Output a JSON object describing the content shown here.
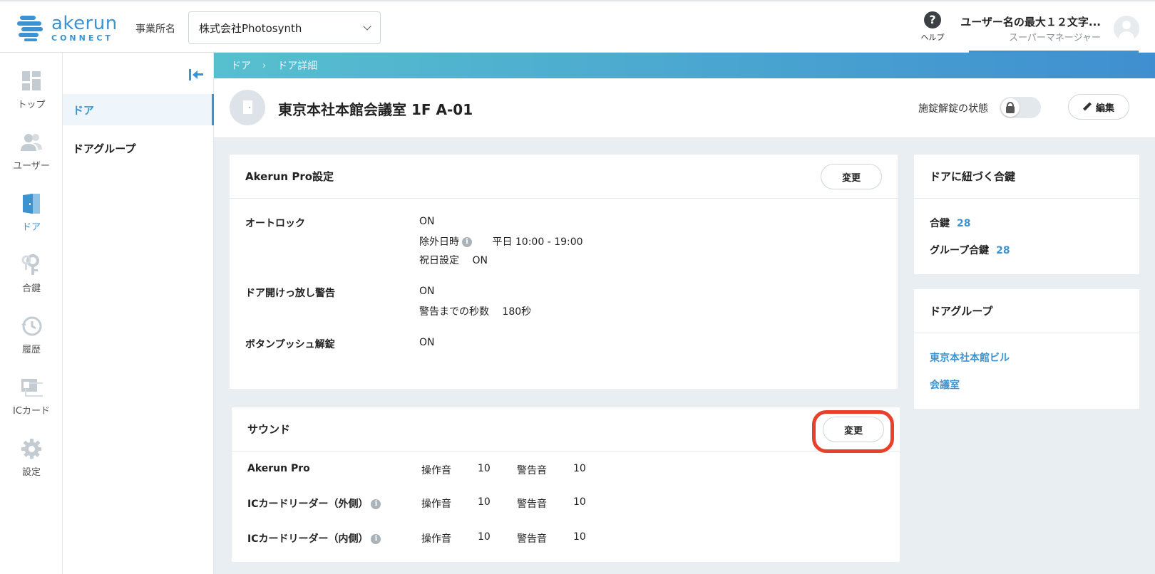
{
  "header": {
    "logo_text": "akerun",
    "logo_sub": "CONNECT",
    "office_label": "事業所名",
    "office_value": "株式会社Photosynth",
    "help_label": "ヘルプ",
    "user_name": "ユーザー名の最大１２文字...",
    "user_role": "スーパーマネージャー"
  },
  "rail": {
    "items": [
      {
        "label": "トップ",
        "icon": "dashboard-icon"
      },
      {
        "label": "ユーザー",
        "icon": "users-icon"
      },
      {
        "label": "ドア",
        "icon": "door-icon"
      },
      {
        "label": "合鍵",
        "icon": "key-icon"
      },
      {
        "label": "履歴",
        "icon": "history-icon"
      },
      {
        "label": "ICカード",
        "icon": "ic-card-icon"
      },
      {
        "label": "設定",
        "icon": "gear-icon"
      }
    ],
    "active_index": 2
  },
  "subnav": {
    "items": [
      {
        "label": "ドア"
      },
      {
        "label": "ドアグループ"
      }
    ]
  },
  "breadcrumb": {
    "items": [
      "ドア",
      "ドア詳細"
    ],
    "separator": "›"
  },
  "title": {
    "name": "東京本社本館会議室 1F A-01",
    "lock_state_label": "施錠解錠の状態",
    "edit_label": "編集"
  },
  "akerun_pro": {
    "heading": "Akerun Pro設定",
    "change_label": "変更",
    "autolock_label": "オートロック",
    "autolock_value": "ON",
    "exclusion_label": "除外日時",
    "exclusion_value": "平日 10:00 - 19:00",
    "holiday_label": "祝日設定",
    "holiday_value": "ON",
    "door_open_label": "ドア開けっ放し警告",
    "door_open_value": "ON",
    "warning_seconds_label": "警告までの秒数",
    "warning_seconds_value": "180秒",
    "button_push_label": "ボタンプッシュ解錠",
    "button_push_value": "ON"
  },
  "sound": {
    "heading": "サウンド",
    "change_label": "変更",
    "rows": [
      {
        "device": "Akerun Pro",
        "op_label": "操作音",
        "op_value": "10",
        "warn_label": "警告音",
        "warn_value": "10"
      },
      {
        "device": "ICカードリーダー（外側）",
        "op_label": "操作音",
        "op_value": "10",
        "warn_label": "警告音",
        "warn_value": "10"
      },
      {
        "device": "ICカードリーダー（内側）",
        "op_label": "操作音",
        "op_value": "10",
        "warn_label": "警告音",
        "warn_value": "10"
      }
    ]
  },
  "keys": {
    "heading": "ドアに紐づく合鍵",
    "key_label": "合鍵",
    "key_count": "28",
    "group_key_label": "グループ合鍵",
    "group_key_count": "28"
  },
  "door_groups": {
    "heading": "ドアグループ",
    "items": [
      "東京本社本館ビル",
      "会議室"
    ]
  },
  "colors": {
    "accent": "#3d93cf",
    "highlight": "#e8402a"
  }
}
